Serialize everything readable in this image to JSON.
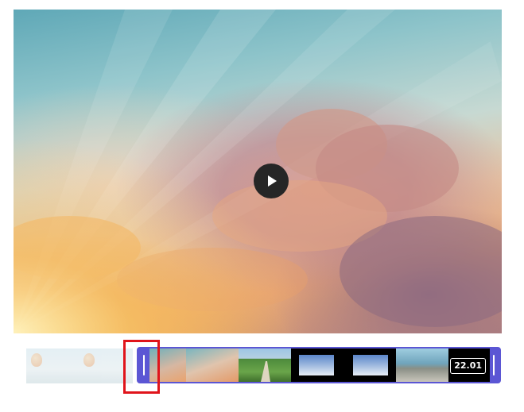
{
  "player": {
    "play_icon": "play-icon"
  },
  "timeline": {
    "duration": "22.01",
    "handle_icon": "grip-icon",
    "thumbnails": [
      "sunrise-clouds",
      "sunrise-clouds",
      "green-valley-road",
      "ice-floe",
      "ice-floe",
      "sea-cliffs"
    ]
  },
  "colors": {
    "accent": "#5b56d4",
    "highlight": "#e0141b",
    "play_button": "#262626"
  }
}
